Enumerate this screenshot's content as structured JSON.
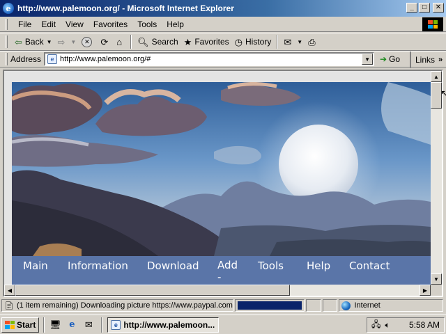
{
  "window": {
    "title": "http://www.palemoon.org/ - Microsoft Internet Explorer",
    "minimize": "_",
    "maximize": "□",
    "close": "✕"
  },
  "menu": [
    "File",
    "Edit",
    "View",
    "Favorites",
    "Tools",
    "Help"
  ],
  "toolbar": {
    "back": "Back",
    "search": "Search",
    "favorites": "Favorites",
    "history": "History"
  },
  "address": {
    "label": "Address",
    "url": "http://www.palemoon.org/#",
    "go": "Go",
    "links": "Links",
    "links_more": "»"
  },
  "site": {
    "nav": [
      {
        "label": "Main"
      },
      {
        "label": "Information"
      },
      {
        "label": "Download"
      },
      {
        "label": "Add\n-"
      },
      {
        "label": "Tools"
      },
      {
        "label": "Help"
      },
      {
        "label": "Contact"
      }
    ],
    "colors": {
      "nav_bg": "#5a75a8",
      "page_bg": "#e4e4e4"
    }
  },
  "status": {
    "message": "(1 item remaining) Downloading picture https://www.paypal.com",
    "progress": 1.0,
    "zone": "Internet"
  },
  "taskbar": {
    "start": "Start",
    "task": "http://www.palemoon...",
    "clock": "5:58 AM"
  }
}
